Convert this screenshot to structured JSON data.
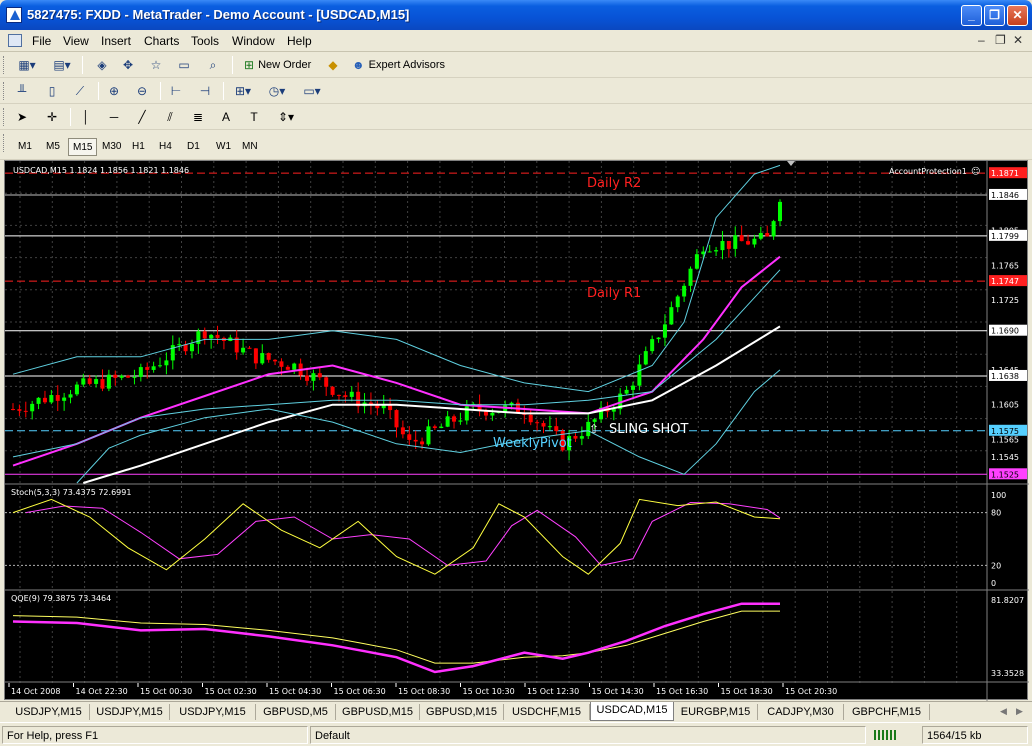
{
  "window": {
    "title": "5827475: FXDD - MetaTrader - Demo Account - [USDCAD,M15]"
  },
  "menu": {
    "items": [
      "File",
      "View",
      "Insert",
      "Charts",
      "Tools",
      "Window",
      "Help"
    ]
  },
  "toolbar": {
    "new_order_label": "New Order",
    "expert_advisors_label": "Expert Advisors"
  },
  "timeframes": {
    "items": [
      "M1",
      "M5",
      "M15",
      "M30",
      "H1",
      "H4",
      "D1",
      "W1",
      "MN"
    ],
    "active": "M15"
  },
  "chart": {
    "header": "USDCAD,M15  1.1824 1.1856 1.1821 1.1846",
    "expert_label": "AccountProtection1",
    "price_labels": [
      "1.1871",
      "1.1846",
      "1.1805",
      "1.1799",
      "1.1765",
      "1.1747",
      "1.1725",
      "1.1690",
      "1.1645",
      "1.1638",
      "1.1605",
      "1.1575",
      "1.1565",
      "1.1545",
      "1.1525"
    ],
    "annotations": {
      "daily_r2": "Daily R2",
      "daily_r1": "Daily R1",
      "weekly_pivot": "WeeklyPivot",
      "sling_shot": "SLING SHOT",
      "sling_shot_arrow": "⇧"
    },
    "stoch": {
      "label": "Stoch(5,3,3) 73.4375 72.6991",
      "levels": [
        "100",
        "80",
        "20",
        "0"
      ]
    },
    "qqe": {
      "label": "QQE(9) 79.3875 73.3464",
      "levels": [
        "81.8207",
        "33.3528"
      ]
    },
    "time_labels": [
      "14 Oct 2008",
      "14 Oct 22:30",
      "15 Oct 00:30",
      "15 Oct 02:30",
      "15 Oct 04:30",
      "15 Oct 06:30",
      "15 Oct 08:30",
      "15 Oct 10:30",
      "15 Oct 12:30",
      "15 Oct 14:30",
      "15 Oct 16:30",
      "15 Oct 18:30",
      "15 Oct 20:30"
    ]
  },
  "tabs": {
    "items": [
      "USDJPY,M15",
      "USDJPY,M15",
      "USDJPY,M15",
      "GBPUSD,M5",
      "GBPUSD,M15",
      "GBPUSD,M15",
      "USDCHF,M15",
      "USDCAD,M15",
      "EURGBP,M15",
      "CADJPY,M30",
      "GBPCHF,M15"
    ],
    "active_index": 7
  },
  "status": {
    "help": "For Help, press F1",
    "profile": "Default",
    "traffic": "1564/15 kb"
  },
  "colors": {
    "chart_bg": "#000000",
    "bull": "#00ff00",
    "bear": "#ff0000",
    "pivot_red": "#ff2020",
    "weekly_pivot": "#55d0ff",
    "band": "#5fd0e0",
    "ma_fast": "#ff30ff",
    "ma_slow": "#ffffff",
    "stoch_main": "#ffff40",
    "stoch_signal": "#ff40ff",
    "qqe_main": "#ff30ff",
    "qqe_signal": "#ffff60"
  }
}
